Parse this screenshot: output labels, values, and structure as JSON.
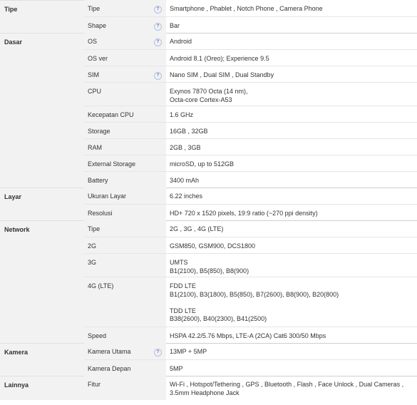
{
  "help_icon": "question-circle-icon",
  "help_glyph": "?",
  "categories": [
    {
      "name": "Tipe",
      "rows": [
        {
          "label": "Tipe",
          "value": "Smartphone , Phablet , Notch Phone , Camera Phone",
          "help": true
        },
        {
          "label": "Shape",
          "value": "Bar",
          "help": true
        }
      ]
    },
    {
      "name": "Dasar",
      "rows": [
        {
          "label": "OS",
          "value": "Android",
          "help": true
        },
        {
          "label": "OS ver",
          "value": "Android 8.1 (Oreo); Experience 9.5",
          "help": false
        },
        {
          "label": "SIM",
          "value": "Nano SIM , Dual SIM , Dual Standby",
          "help": true
        },
        {
          "label": "CPU",
          "value": "Exynos 7870 Octa (14 nm),\nOcta-core Cortex-A53",
          "help": false
        },
        {
          "label": "Kecepatan CPU",
          "value": "1.6 GHz",
          "help": false
        },
        {
          "label": "Storage",
          "value": "16GB , 32GB",
          "help": false
        },
        {
          "label": "RAM",
          "value": "2GB , 3GB",
          "help": false
        },
        {
          "label": "External Storage",
          "value": "microSD, up to 512GB",
          "help": false
        },
        {
          "label": "Battery",
          "value": "3400 mAh",
          "help": false
        }
      ]
    },
    {
      "name": "Layar",
      "rows": [
        {
          "label": "Ukuran Layar",
          "value": "6.22 inches",
          "help": false
        },
        {
          "label": "Resolusi",
          "value": "HD+ 720 x 1520 pixels, 19:9 ratio (~270 ppi density)",
          "help": false
        }
      ]
    },
    {
      "name": "Network",
      "rows": [
        {
          "label": "Tipe",
          "value": "2G , 3G , 4G (LTE)",
          "help": false
        },
        {
          "label": "2G",
          "value": "GSM850, GSM900, DCS1800",
          "help": false
        },
        {
          "label": "3G",
          "value": "UMTS\nB1(2100), B5(850), B8(900)",
          "help": false
        },
        {
          "label": "4G (LTE)",
          "value": "FDD LTE\nB1(2100), B3(1800), B5(850), B7(2600), B8(900), B20(800)\n\nTDD LTE\nB38(2600), B40(2300), B41(2500)",
          "help": false
        },
        {
          "label": "Speed",
          "value": "HSPA 42.2/5.76 Mbps, LTE-A (2CA) Cat6 300/50 Mbps",
          "help": false
        }
      ]
    },
    {
      "name": "Kamera",
      "rows": [
        {
          "label": "Kamera Utama",
          "value": "13MP + 5MP",
          "help": true
        },
        {
          "label": "Kamera Depan",
          "value": "5MP",
          "help": false
        }
      ]
    },
    {
      "name": "Lainnya",
      "rows": [
        {
          "label": "Fitur",
          "value": "Wi-Fi , Hotspot/Tethering , GPS , Bluetooth , Flash , Face Unlock , Dual Cameras ,\n3.5mm Headphone Jack",
          "help": false
        }
      ]
    }
  ]
}
